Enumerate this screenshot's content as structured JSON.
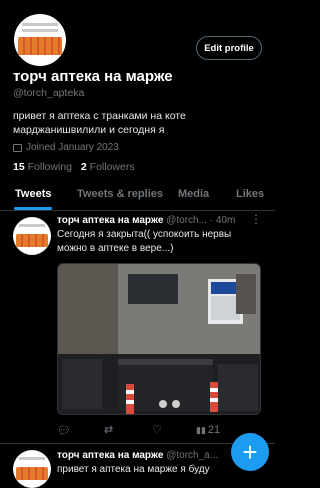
{
  "profile": {
    "edit_label": "Edit profile",
    "name": "торч аптека на марже",
    "handle": "@torch_apteka",
    "bio_line1": "привет я аптека с транками на коте",
    "bio_line2": "марджанишвилили и сегодня я",
    "joined": "Joined January 2023",
    "following_count": "15",
    "following_label": "Following",
    "followers_count": "2",
    "followers_label": "Followers"
  },
  "tabs": [
    "Tweets",
    "Tweets & replies",
    "Media",
    "Likes"
  ],
  "tweet1": {
    "name": "торч аптека на марже",
    "handle_time": "@torch...",
    "time": "· 40m",
    "text_line1": "Сегодня я закрыта(( успокоить нервы",
    "text_line2": "можно в аптеке в вере...)",
    "reply_count": "",
    "retweet_count": "",
    "like_count": "",
    "views_count": "21"
  },
  "tweet2": {
    "name": "торч аптека на марже",
    "handle": "@torch_a...",
    "text": "привет я аптека на марже я буду"
  },
  "fab": {
    "icon": "plus-icon"
  },
  "colors": {
    "accent": "#1d9bf0",
    "muted": "#71767b"
  }
}
